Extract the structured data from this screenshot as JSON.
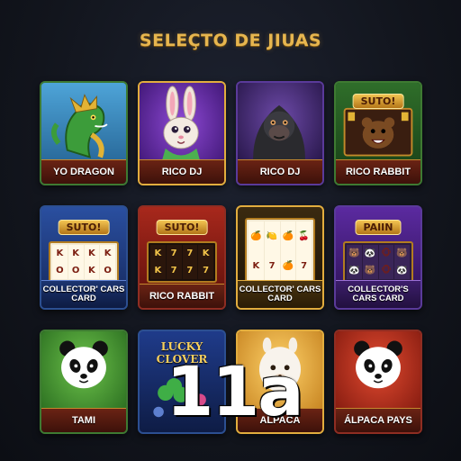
{
  "page_title": "SELEÇTO DE JIUAS",
  "overlay_text": "11a",
  "colors": {
    "title_gold": "#e7b64f",
    "background": "#12151d",
    "label_red": "#6a2314"
  },
  "tiles": [
    {
      "label": "YO DRAGON",
      "icon": "green-dragon-icon"
    },
    {
      "label": "RICO DJ",
      "icon": "rabbit-icon"
    },
    {
      "label": "RICO DJ",
      "icon": "gorilla-icon"
    },
    {
      "label": "RICO RABBIT",
      "icon": "bear-slot-machine-icon",
      "sign": "SUTO!"
    },
    {
      "label": "COLLECTOR' CARS CARD",
      "icon": "slot-machine-icon",
      "sign": "SUTO!",
      "reels": [
        "K",
        "K",
        "K",
        "K",
        "O",
        "O",
        "K",
        "O"
      ]
    },
    {
      "label": "RICO RABBIT",
      "icon": "slot-machine-icon",
      "sign": "SUTO!",
      "reels": [
        "K",
        "7",
        "7",
        "K",
        "K",
        "7",
        "7",
        "7"
      ]
    },
    {
      "label": "COLLECTOR' CARS CARD",
      "icon": "fruit-slot-icon",
      "reels": [
        "🍊",
        "🍋",
        "🍊",
        "🍒",
        "K",
        "7",
        "🍊",
        "7"
      ]
    },
    {
      "label": "COLLECTOR'S CARS CARD",
      "icon": "animal-slot-icon",
      "sign": "PAIIN",
      "reels": [
        "🐻",
        "🐼",
        "🐵",
        "🐻",
        "🐼",
        "🐻",
        "🐵",
        "🐼"
      ]
    },
    {
      "label": "TAMI",
      "icon": "panda-icon"
    },
    {
      "label": "",
      "icon": "lucky-clover-slot-icon",
      "art_text": "LUCKY CLOVER"
    },
    {
      "label": "ALPACA",
      "icon": "alpaca-icon"
    },
    {
      "label": "ÁLPACA PAYS",
      "icon": "panda-icon"
    }
  ]
}
